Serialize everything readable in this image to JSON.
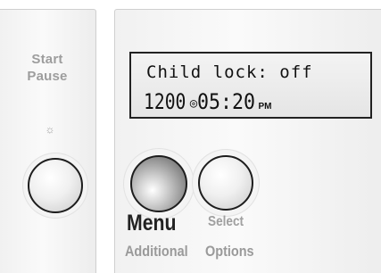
{
  "left_panel": {
    "start_label": "Start",
    "pause_label": "Pause",
    "indicator_icon": "status-light-icon",
    "indicator_glyph": "☼"
  },
  "display": {
    "line1": "Child lock: off",
    "counter": "1200",
    "clock_icon": "clock-icon",
    "clock_glyph": "◎",
    "time": "05:20",
    "ampm": "PM"
  },
  "buttons": {
    "menu_label": "Menu",
    "menu_sublabel": "Additional",
    "select_label": "Select",
    "select_sublabel": "Options"
  },
  "colors": {
    "label_gray": "#9d9d9d",
    "menu_label": "#222222",
    "lcd_background": "#e9e9e9",
    "lcd_text": "#111111"
  }
}
